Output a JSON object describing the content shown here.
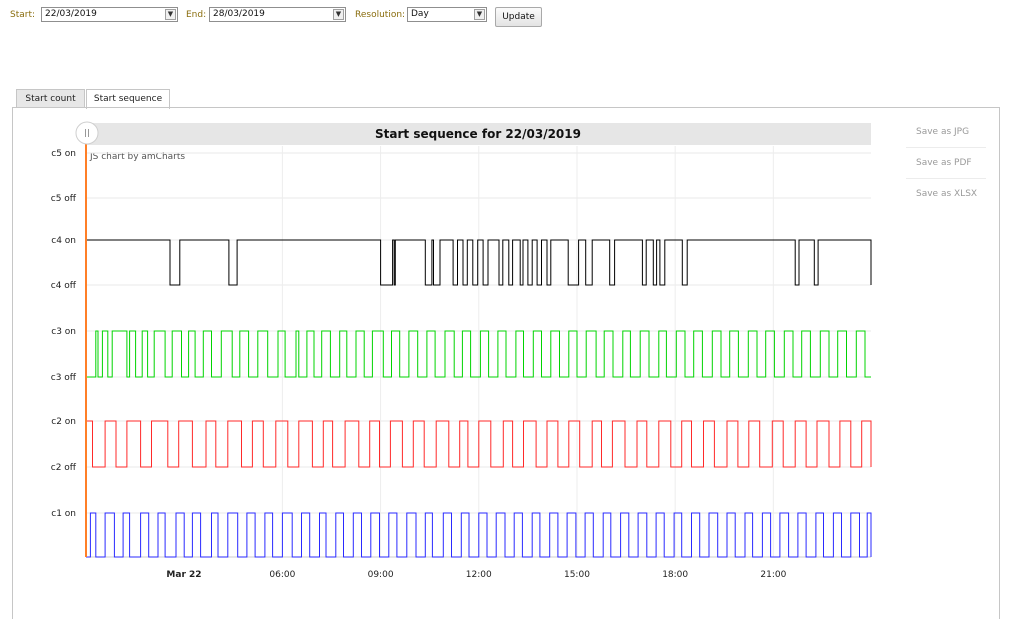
{
  "toolbar": {
    "start_label": "Start:",
    "start_value": "22/03/2019",
    "end_label": "End:",
    "end_value": "28/03/2019",
    "resolution_label": "Resolution:",
    "resolution_value": "Day",
    "update_label": "Update"
  },
  "tabs": [
    {
      "label": "Start count",
      "active": false
    },
    {
      "label": "Start sequence",
      "active": true
    }
  ],
  "export_menu": [
    "Save as JPG",
    "Save as PDF",
    "Save as XLSX"
  ],
  "chart": {
    "credit": "JS chart by amCharts",
    "scroll_handle_icon": "pause-grip-icon"
  },
  "chart_data": {
    "type": "line",
    "title": "Start sequence for 22/03/2019",
    "x_range": [
      "2019-03-22 00:00",
      "2019-03-22 23:59"
    ],
    "x_ticks": [
      "Mar 22",
      "06:00",
      "09:00",
      "12:00",
      "15:00",
      "18:00",
      "21:00"
    ],
    "y_ticks": [
      "c5 on",
      "c5 off",
      "c4 on",
      "c4 off",
      "c3 on",
      "c3 off",
      "c2 on",
      "c2 off",
      "c1 on"
    ],
    "grid": true,
    "series": [
      {
        "name": "c4",
        "color": "#000000",
        "low_label": "c4 off",
        "high_label": "c4 on",
        "on_intervals": [
          [
            "00:00",
            "02:34"
          ],
          [
            "02:52",
            "04:22"
          ],
          [
            "04:37",
            "09:00"
          ],
          [
            "09:22",
            "09:25"
          ],
          [
            "09:27",
            "10:22"
          ],
          [
            "10:34",
            "10:37"
          ],
          [
            "10:49",
            "11:13"
          ],
          [
            "11:21",
            "11:31"
          ],
          [
            "11:39",
            "11:49"
          ],
          [
            "11:58",
            "12:08"
          ],
          [
            "12:17",
            "12:37"
          ],
          [
            "12:44",
            "12:55"
          ],
          [
            "13:02",
            "13:16"
          ],
          [
            "13:21",
            "13:30"
          ],
          [
            "13:38",
            "13:47"
          ],
          [
            "13:55",
            "14:05"
          ],
          [
            "14:12",
            "14:44"
          ],
          [
            "15:03",
            "15:16"
          ],
          [
            "15:28",
            "16:00"
          ],
          [
            "16:09",
            "17:00"
          ],
          [
            "17:07",
            "17:20"
          ],
          [
            "17:26",
            "17:32"
          ],
          [
            "17:41",
            "18:13"
          ],
          [
            "18:22",
            "21:40"
          ],
          [
            "21:47",
            "22:15"
          ],
          [
            "22:22",
            "23:59"
          ]
        ]
      },
      {
        "name": "c3",
        "color": "#00d400",
        "low_label": "c3 off",
        "high_label": "c3 on",
        "on_intervals": [
          [
            "00:18",
            "00:22"
          ],
          [
            "00:30",
            "00:40"
          ],
          [
            "00:48",
            "01:15"
          ],
          [
            "01:20",
            "01:31"
          ],
          [
            "01:43",
            "01:53"
          ],
          [
            "02:05",
            "02:25"
          ],
          [
            "02:38",
            "02:55"
          ],
          [
            "03:08",
            "03:20"
          ],
          [
            "03:35",
            "03:50"
          ],
          [
            "04:08",
            "04:28"
          ],
          [
            "04:42",
            "04:58"
          ],
          [
            "05:15",
            "05:33"
          ],
          [
            "05:52",
            "06:05"
          ],
          [
            "06:25",
            "06:30"
          ],
          [
            "06:45",
            "06:58"
          ],
          [
            "07:12",
            "07:28"
          ],
          [
            "07:45",
            "07:58"
          ],
          [
            "08:15",
            "08:30"
          ],
          [
            "08:45",
            "09:05"
          ],
          [
            "09:20",
            "09:35"
          ],
          [
            "09:52",
            "10:08"
          ],
          [
            "10:25",
            "10:40"
          ],
          [
            "10:58",
            "11:15"
          ],
          [
            "11:30",
            "11:45"
          ],
          [
            "12:03",
            "12:18"
          ],
          [
            "12:35",
            "12:50"
          ],
          [
            "13:08",
            "13:22"
          ],
          [
            "13:40",
            "13:55"
          ],
          [
            "14:12",
            "14:28"
          ],
          [
            "14:45",
            "15:00"
          ],
          [
            "15:17",
            "15:35"
          ],
          [
            "15:50",
            "16:06"
          ],
          [
            "16:24",
            "16:38"
          ],
          [
            "16:56",
            "17:12"
          ],
          [
            "17:30",
            "17:44"
          ],
          [
            "18:02",
            "18:18"
          ],
          [
            "18:34",
            "18:50"
          ],
          [
            "19:08",
            "19:24"
          ],
          [
            "19:40",
            "19:56"
          ],
          [
            "20:14",
            "20:30"
          ],
          [
            "20:46",
            "21:02"
          ],
          [
            "21:20",
            "21:36"
          ],
          [
            "21:52",
            "22:08"
          ],
          [
            "22:26",
            "22:42"
          ],
          [
            "22:58",
            "23:14"
          ],
          [
            "23:32",
            "23:48"
          ]
        ]
      },
      {
        "name": "c2",
        "color": "#ff2a2a",
        "low_label": "c2 off",
        "high_label": "c2 on",
        "on_intervals": [
          [
            "00:00",
            "00:12"
          ],
          [
            "00:35",
            "00:55"
          ],
          [
            "01:15",
            "01:40"
          ],
          [
            "02:00",
            "02:30"
          ],
          [
            "02:50",
            "03:15"
          ],
          [
            "03:40",
            "03:58"
          ],
          [
            "04:20",
            "04:45"
          ],
          [
            "05:05",
            "05:25"
          ],
          [
            "05:48",
            "06:10"
          ],
          [
            "06:30",
            "06:55"
          ],
          [
            "07:15",
            "07:32"
          ],
          [
            "07:55",
            "08:20"
          ],
          [
            "08:40",
            "08:58"
          ],
          [
            "09:18",
            "09:40"
          ],
          [
            "10:00",
            "10:20"
          ],
          [
            "10:42",
            "11:05"
          ],
          [
            "11:25",
            "11:40"
          ],
          [
            "12:00",
            "12:22"
          ],
          [
            "12:45",
            "13:02"
          ],
          [
            "13:22",
            "13:45"
          ],
          [
            "14:05",
            "14:25"
          ],
          [
            "14:45",
            "15:05"
          ],
          [
            "15:28",
            "15:45"
          ],
          [
            "16:05",
            "16:28"
          ],
          [
            "16:50",
            "17:08"
          ],
          [
            "17:30",
            "17:52"
          ],
          [
            "18:12",
            "18:30"
          ],
          [
            "18:52",
            "19:12"
          ],
          [
            "19:35",
            "19:55"
          ],
          [
            "20:15",
            "20:35"
          ],
          [
            "20:58",
            "21:18"
          ],
          [
            "21:40",
            "22:00"
          ],
          [
            "22:20",
            "22:42"
          ],
          [
            "23:02",
            "23:22"
          ],
          [
            "23:42",
            "23:59"
          ]
        ]
      },
      {
        "name": "c1",
        "color": "#2a2aff",
        "low_label": "",
        "high_label": "c1 on",
        "on_intervals": [
          [
            "00:08",
            "00:18"
          ],
          [
            "00:35",
            "00:52"
          ],
          [
            "01:08",
            "01:20"
          ],
          [
            "01:40",
            "01:55"
          ],
          [
            "02:12",
            "02:25"
          ],
          [
            "02:45",
            "03:00"
          ],
          [
            "03:15",
            "03:30"
          ],
          [
            "03:50",
            "04:02"
          ],
          [
            "04:20",
            "04:38"
          ],
          [
            "04:55",
            "05:10"
          ],
          [
            "05:28",
            "05:42"
          ],
          [
            "06:00",
            "06:18"
          ],
          [
            "06:35",
            "06:50"
          ],
          [
            "07:08",
            "07:20"
          ],
          [
            "07:38",
            "07:52"
          ],
          [
            "08:10",
            "08:25"
          ],
          [
            "08:42",
            "08:58"
          ],
          [
            "09:15",
            "09:30"
          ],
          [
            "09:48",
            "10:05"
          ],
          [
            "10:22",
            "10:35"
          ],
          [
            "10:55",
            "11:10"
          ],
          [
            "11:28",
            "11:42"
          ],
          [
            "12:00",
            "12:15"
          ],
          [
            "12:32",
            "12:48"
          ],
          [
            "13:05",
            "13:20"
          ],
          [
            "13:38",
            "13:52"
          ],
          [
            "14:10",
            "14:25"
          ],
          [
            "14:42",
            "14:58"
          ],
          [
            "15:15",
            "15:30"
          ],
          [
            "15:48",
            "16:02"
          ],
          [
            "16:20",
            "16:35"
          ],
          [
            "16:52",
            "17:08"
          ],
          [
            "17:25",
            "17:40"
          ],
          [
            "17:58",
            "18:12"
          ],
          [
            "18:30",
            "18:45"
          ],
          [
            "19:02",
            "19:18"
          ],
          [
            "19:35",
            "19:50"
          ],
          [
            "20:08",
            "20:22"
          ],
          [
            "20:40",
            "20:55"
          ],
          [
            "21:12",
            "21:28"
          ],
          [
            "21:45",
            "22:00"
          ],
          [
            "22:18",
            "22:32"
          ],
          [
            "22:50",
            "23:05"
          ],
          [
            "23:22",
            "23:38"
          ],
          [
            "23:52",
            "23:59"
          ]
        ]
      }
    ]
  }
}
